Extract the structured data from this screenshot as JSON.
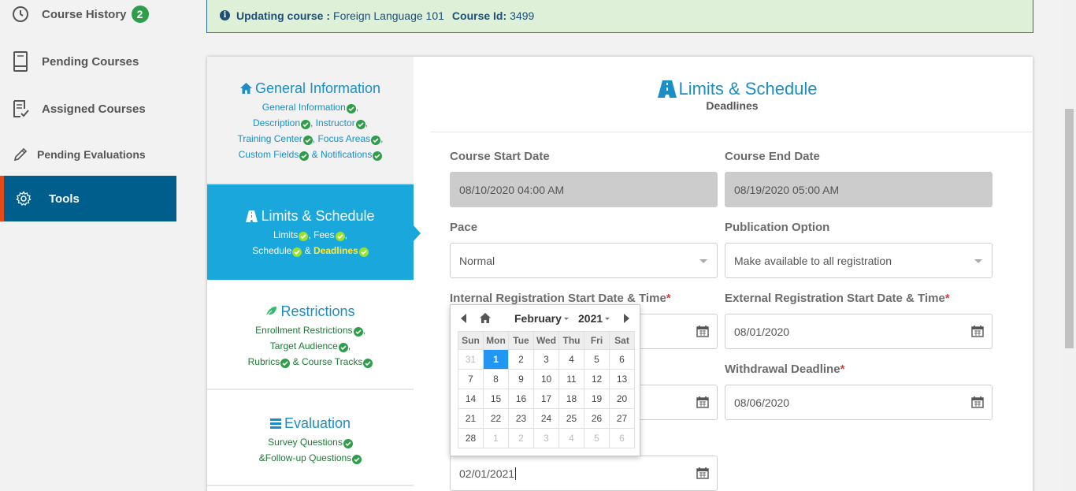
{
  "sidebar": {
    "items": [
      {
        "label": "Course History",
        "badge": "2",
        "icon": "clock-history-icon"
      },
      {
        "label": "Pending Courses",
        "icon": "book-icon"
      },
      {
        "label": "Assigned Courses",
        "icon": "checklist-icon"
      },
      {
        "label": "Pending Evaluations",
        "icon": "pencil-icon"
      },
      {
        "label": "Tools",
        "icon": "gear-icon",
        "active": true
      }
    ]
  },
  "alert": {
    "updating_label": "Updating course :",
    "course_name": "Foreign Language 101",
    "course_id_label": "Course Id:",
    "course_id": "3499"
  },
  "steps": {
    "general": {
      "title": "General Information",
      "line1": "General Information",
      "line2a": "Description",
      "line2b": "Instructor",
      "line3a": "Training Center",
      "line3b": "Focus Areas",
      "line4a": "Custom Fields",
      "line4b": "& Notifications"
    },
    "limits": {
      "title": "Limits & Schedule",
      "line1a": "Limits",
      "line1b": "Fees",
      "line2a": "Schedule",
      "amp": "&",
      "line2b": "Deadlines"
    },
    "restrictions": {
      "title": "Restrictions",
      "line1": "Enrollment Restrictions",
      "line2": "Target Audience",
      "line3a": "Rubrics",
      "line3b": "& Course Tracks"
    },
    "evaluation": {
      "title": "Evaluation",
      "line1": "Survey Questions",
      "line2": "&Follow-up Questions"
    }
  },
  "form": {
    "header_title": "Limits & Schedule",
    "header_subtitle": "Deadlines",
    "course_start_label": "Course Start Date",
    "course_start_value": "08/10/2020 04:00 AM",
    "course_end_label": "Course End Date",
    "course_end_value": "08/19/2020 05:00 AM",
    "pace_label": "Pace",
    "pace_value": "Normal",
    "publication_label": "Publication Option",
    "publication_value": "Make available to all registration",
    "internal_reg_label": "Internal Registration Start Date & Time",
    "external_reg_label": "External Registration Start Date & Time",
    "external_reg_value": "08/01/2020",
    "withdrawal_label": "Withdrawal Deadline",
    "withdrawal_value": "08/06/2020",
    "bottom_date_value": "02/01/2021",
    "required_mark": "*"
  },
  "datepicker": {
    "month": "February",
    "year": "2021",
    "weekdays": [
      "Sun",
      "Mon",
      "Tue",
      "Wed",
      "Thu",
      "Fri",
      "Sat"
    ],
    "weeks": [
      [
        "31",
        "1",
        "2",
        "3",
        "4",
        "5",
        "6"
      ],
      [
        "7",
        "8",
        "9",
        "10",
        "11",
        "12",
        "13"
      ],
      [
        "14",
        "15",
        "16",
        "17",
        "18",
        "19",
        "20"
      ],
      [
        "21",
        "22",
        "23",
        "24",
        "25",
        "26",
        "27"
      ],
      [
        "28",
        "1",
        "2",
        "3",
        "4",
        "5",
        "6"
      ]
    ],
    "selected": "1"
  },
  "colors": {
    "primary": "#1a8ec7",
    "active_step": "#1aa7dc",
    "sidebar_active": "#005e8c",
    "success": "#2e9e4a"
  }
}
